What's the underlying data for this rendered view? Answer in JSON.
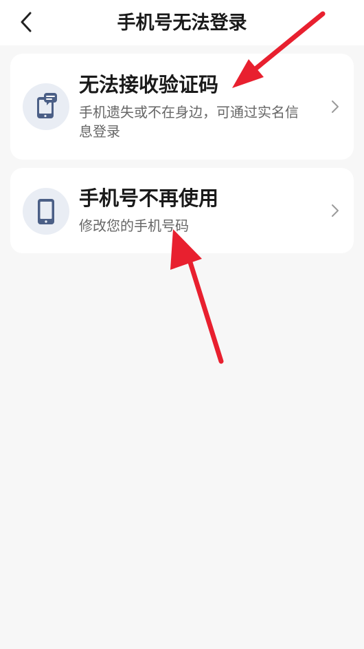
{
  "header": {
    "title": "手机号无法登录",
    "back_icon": "chevron-left-icon"
  },
  "options": [
    {
      "title": "无法接收验证码",
      "description": "手机遗失或不在身边，可通过实名信息登录",
      "icon": "phone-message-icon"
    },
    {
      "title": "手机号不再使用",
      "description": "修改您的手机号码",
      "icon": "mobile-phone-icon"
    }
  ],
  "colors": {
    "background": "#f7f7f7",
    "card": "#ffffff",
    "icon_bg": "#e9edf4",
    "icon_fg": "#4b5f86",
    "arrow": "#e8202f"
  }
}
